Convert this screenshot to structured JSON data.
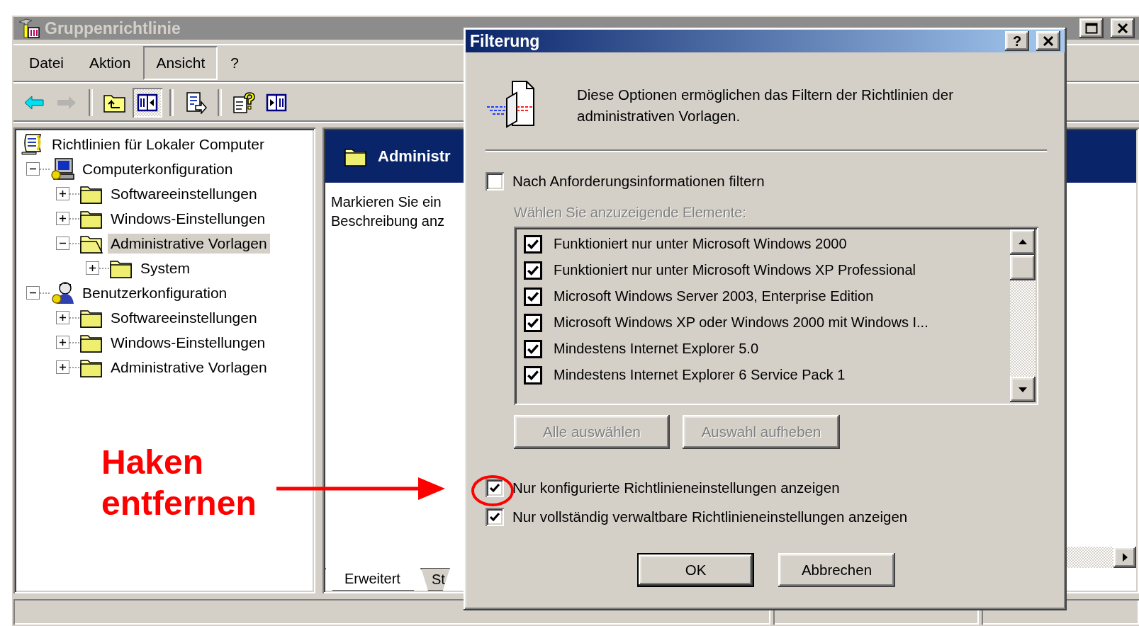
{
  "window": {
    "title": "Gruppenrichtlinie"
  },
  "menu": [
    {
      "label": "Datei",
      "selected": false
    },
    {
      "label": "Aktion",
      "selected": false
    },
    {
      "label": "Ansicht",
      "selected": true
    },
    {
      "label": "?",
      "selected": false
    }
  ],
  "toolbar": [
    {
      "kind": "back",
      "disabled": false,
      "pressed": false
    },
    {
      "kind": "forward",
      "disabled": true,
      "pressed": false
    },
    {
      "kind": "separator"
    },
    {
      "kind": "up",
      "disabled": false,
      "pressed": false
    },
    {
      "kind": "tree",
      "disabled": false,
      "pressed": true
    },
    {
      "kind": "separator"
    },
    {
      "kind": "export",
      "disabled": false,
      "pressed": false
    },
    {
      "kind": "separator"
    },
    {
      "kind": "help",
      "disabled": false,
      "pressed": false
    },
    {
      "kind": "pane",
      "disabled": false,
      "pressed": false
    }
  ],
  "tree": {
    "label": "Richtlinien für Lokaler Computer",
    "kind": "policy",
    "selected": false,
    "children": [
      {
        "label": "Computerkonfiguration",
        "kind": "computer",
        "expanded": true,
        "selected": false,
        "children": [
          {
            "label": "Softwareeinstellungen",
            "kind": "folder",
            "expanded": false,
            "selected": false
          },
          {
            "label": "Windows-Einstellungen",
            "kind": "folder",
            "expanded": false,
            "selected": false
          },
          {
            "label": "Administrative Vorlagen",
            "kind": "folder",
            "expanded": true,
            "selected": true,
            "children": [
              {
                "label": "System",
                "kind": "folder",
                "expanded": false,
                "selected": false
              }
            ]
          }
        ]
      },
      {
        "label": "Benutzerkonfiguration",
        "kind": "user",
        "expanded": true,
        "selected": false,
        "children": [
          {
            "label": "Softwareeinstellungen",
            "kind": "folder",
            "expanded": false,
            "selected": false
          },
          {
            "label": "Windows-Einstellungen",
            "kind": "folder",
            "expanded": false,
            "selected": false
          },
          {
            "label": "Administrative Vorlagen",
            "kind": "folder",
            "expanded": false,
            "selected": false
          }
        ]
      }
    ]
  },
  "details": {
    "heading": "Administr",
    "description": [
      "Markieren Sie ein",
      "Beschreibung anz"
    ],
    "tabs": [
      {
        "label": "Erweitert",
        "selected": true
      },
      {
        "label": "St",
        "selected": false
      }
    ]
  },
  "dialog": {
    "title": "Filterung",
    "help": "?",
    "intro": "Diese Optionen ermöglichen das Filtern der Richtlinien der administrativen Vorlagen.",
    "filter": {
      "label": "Nach Anforderungsinformationen filtern",
      "checked": false
    },
    "list_label": "Wählen Sie anzuzeigende Elemente:",
    "items": [
      {
        "label": "Funktioniert nur unter Microsoft Windows 2000",
        "checked": true
      },
      {
        "label": "Funktioniert nur unter Microsoft Windows XP Professional",
        "checked": true
      },
      {
        "label": "Microsoft Windows Server 2003, Enterprise Edition",
        "checked": true
      },
      {
        "label": "Microsoft Windows XP oder Windows 2000 mit Windows I...",
        "checked": true
      },
      {
        "label": "Mindestens Internet Explorer 5.0",
        "checked": true
      },
      {
        "label": "Mindestens Internet Explorer 6 Service Pack 1",
        "checked": true
      }
    ],
    "buttons": [
      "Alle auswählen",
      "Auswahl aufheben"
    ],
    "options": [
      {
        "label": "Nur konfigurierte Richtlinieneinstellungen anzeigen",
        "checked": true
      },
      {
        "label": "Nur vollständig verwaltbare Richtlinieneinstellungen anzeigen",
        "checked": true
      }
    ],
    "ok": "OK",
    "cancel": "Abbrechen"
  },
  "annotation": {
    "text": "Haken entfernen"
  }
}
